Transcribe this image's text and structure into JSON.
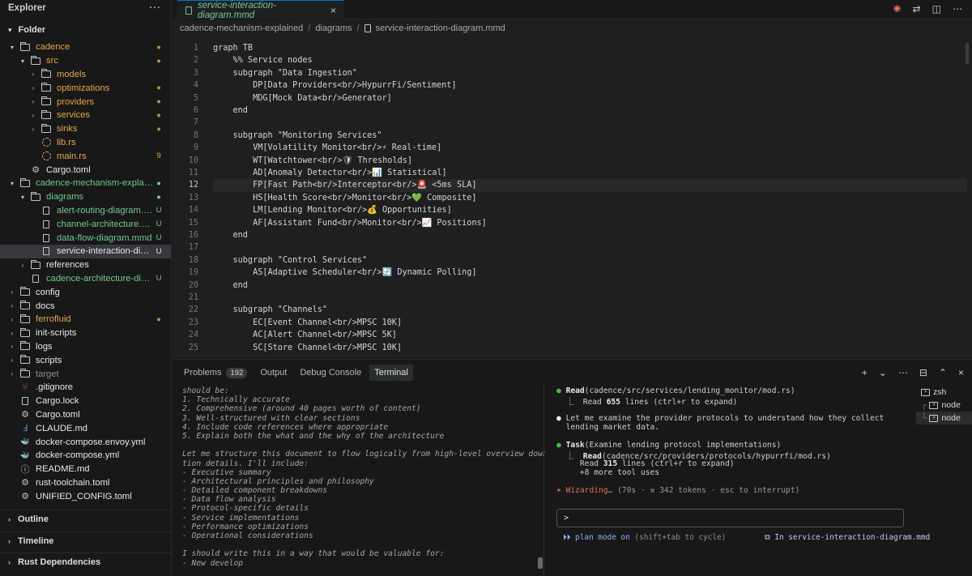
{
  "sidebar": {
    "title": "Explorer",
    "more": "···",
    "folder_header": "Folder",
    "tree": [
      {
        "label": "cadence",
        "kind": "folder",
        "depth": 0,
        "open": true,
        "color": "orange",
        "badge": "●",
        "badge_color": "dim-orange"
      },
      {
        "label": "src",
        "kind": "folder",
        "depth": 1,
        "open": true,
        "color": "orange",
        "badge": "●",
        "badge_color": "dim-orange"
      },
      {
        "label": "models",
        "kind": "folder",
        "depth": 2,
        "open": false,
        "color": "orange",
        "badge": "",
        "badge_color": ""
      },
      {
        "label": "optimizations",
        "kind": "folder",
        "depth": 2,
        "open": false,
        "color": "orange",
        "badge": "●",
        "badge_color": "dim-orange"
      },
      {
        "label": "providers",
        "kind": "folder",
        "depth": 2,
        "open": false,
        "color": "orange",
        "badge": "●",
        "badge_color": "dim-orange"
      },
      {
        "label": "services",
        "kind": "folder",
        "depth": 2,
        "open": false,
        "color": "orange",
        "badge": "●",
        "badge_color": "dim-orange"
      },
      {
        "label": "sinks",
        "kind": "folder",
        "depth": 2,
        "open": false,
        "color": "orange",
        "badge": "●",
        "badge_color": "dim-orange"
      },
      {
        "label": "lib.rs",
        "kind": "rust",
        "depth": 2,
        "color": "orange",
        "badge": "",
        "badge_color": ""
      },
      {
        "label": "main.rs",
        "kind": "rust",
        "depth": 2,
        "color": "orange",
        "badge": "9",
        "badge_color": "orange"
      },
      {
        "label": "Cargo.toml",
        "kind": "gear",
        "depth": 1,
        "color": "white",
        "badge": "",
        "badge_color": ""
      },
      {
        "label": "cadence-mechanism-explained",
        "kind": "folder",
        "depth": 0,
        "open": true,
        "color": "green",
        "badge": "●",
        "badge_color": "green"
      },
      {
        "label": "diagrams",
        "kind": "folder",
        "depth": 1,
        "open": true,
        "color": "green",
        "badge": "●",
        "badge_color": "green"
      },
      {
        "label": "alert-routing-diagram.mmd",
        "kind": "file",
        "depth": 2,
        "color": "green",
        "badge": "U",
        "badge_color": "green"
      },
      {
        "label": "channel-architecture.mmd",
        "kind": "file",
        "depth": 2,
        "color": "green",
        "badge": "U",
        "badge_color": "green"
      },
      {
        "label": "data-flow-diagram.mmd",
        "kind": "file",
        "depth": 2,
        "color": "green",
        "badge": "U",
        "badge_color": "green"
      },
      {
        "label": "service-interaction-diagr...",
        "kind": "file",
        "depth": 2,
        "color": "white",
        "badge": "U",
        "badge_color": "white",
        "selected": true
      },
      {
        "label": "references",
        "kind": "folder",
        "depth": 1,
        "open": false,
        "color": "white",
        "badge": "",
        "badge_color": ""
      },
      {
        "label": "cadence-architecture-diagra...",
        "kind": "file",
        "depth": 1,
        "color": "green",
        "badge": "U",
        "badge_color": "green"
      },
      {
        "label": "config",
        "kind": "folder",
        "depth": 0,
        "open": false,
        "color": "white",
        "badge": "",
        "badge_color": ""
      },
      {
        "label": "docs",
        "kind": "folder",
        "depth": 0,
        "open": false,
        "color": "white",
        "badge": "",
        "badge_color": ""
      },
      {
        "label": "ferrofluid",
        "kind": "folder",
        "depth": 0,
        "open": false,
        "color": "orange",
        "badge": "●",
        "badge_color": "dim-orange"
      },
      {
        "label": "init-scripts",
        "kind": "folder",
        "depth": 0,
        "open": false,
        "color": "white",
        "badge": "",
        "badge_color": ""
      },
      {
        "label": "logs",
        "kind": "folder",
        "depth": 0,
        "open": false,
        "color": "white",
        "badge": "",
        "badge_color": ""
      },
      {
        "label": "scripts",
        "kind": "folder",
        "depth": 0,
        "open": false,
        "color": "white",
        "badge": "",
        "badge_color": ""
      },
      {
        "label": "target",
        "kind": "folder",
        "depth": 0,
        "open": false,
        "color": "dim",
        "badge": "",
        "badge_color": ""
      },
      {
        "label": ".gitignore",
        "kind": "git",
        "depth": 0,
        "color": "white",
        "badge": "",
        "badge_color": ""
      },
      {
        "label": "Cargo.lock",
        "kind": "file",
        "depth": 0,
        "color": "white",
        "badge": "",
        "badge_color": ""
      },
      {
        "label": "Cargo.toml",
        "kind": "gear",
        "depth": 0,
        "color": "white",
        "badge": "",
        "badge_color": ""
      },
      {
        "label": "CLAUDE.md",
        "kind": "md",
        "depth": 0,
        "color": "white",
        "badge": "",
        "badge_color": ""
      },
      {
        "label": "docker-compose.envoy.yml",
        "kind": "docker",
        "depth": 0,
        "color": "white",
        "badge": "",
        "badge_color": ""
      },
      {
        "label": "docker-compose.yml",
        "kind": "docker",
        "depth": 0,
        "color": "white",
        "badge": "",
        "badge_color": ""
      },
      {
        "label": "README.md",
        "kind": "info",
        "depth": 0,
        "color": "white",
        "badge": "",
        "badge_color": ""
      },
      {
        "label": "rust-toolchain.toml",
        "kind": "gear",
        "depth": 0,
        "color": "white",
        "badge": "",
        "badge_color": ""
      },
      {
        "label": "UNIFIED_CONFIG.toml",
        "kind": "gear",
        "depth": 0,
        "color": "white",
        "badge": "",
        "badge_color": ""
      }
    ],
    "sections": [
      "Outline",
      "Timeline",
      "Rust Dependencies"
    ]
  },
  "editor": {
    "tab_label": "service-interaction-diagram.mmd",
    "tab_close": "×",
    "breadcrumb": [
      "cadence-mechanism-explained",
      "diagrams",
      "service-interaction-diagram.mmd"
    ],
    "active_line": 12,
    "lines": [
      "graph TB",
      "    %% Service nodes",
      "    subgraph \"Data Ingestion\"",
      "        DP[Data Providers<br/>HypurrFi/Sentiment]",
      "        MDG[Mock Data<br/>Generator]",
      "    end",
      "",
      "    subgraph \"Monitoring Services\"",
      "        VM[Volatility Monitor<br/>⚡ Real-time]",
      "        WT[Watchtower<br/>🛡 Thresholds]",
      "        AD[Anomaly Detector<br/>📊 Statistical]",
      "        FP[Fast Path<br/>Interceptor<br/>🚨 <5ms SLA]",
      "        HS[Health Score<br/>Monitor<br/>💚 Composite]",
      "        LM[Lending Monitor<br/>💰 Opportunities]",
      "        AF[Assistant Fund<br/>Monitor<br/>📈 Positions]",
      "    end",
      "",
      "    subgraph \"Control Services\"",
      "        AS[Adaptive Scheduler<br/>🔄 Dynamic Polling]",
      "    end",
      "",
      "    subgraph \"Channels\"",
      "        EC[Event Channel<br/>MPSC 10K]",
      "        AC[Alert Channel<br/>MPSC 5K]",
      "        SC[Store Channel<br/>MPSC 10K]"
    ]
  },
  "panel": {
    "tabs": [
      {
        "label": "Problems",
        "badge": "192"
      },
      {
        "label": "Output",
        "badge": ""
      },
      {
        "label": "Debug Console",
        "badge": ""
      },
      {
        "label": "Terminal",
        "badge": "",
        "active": true
      }
    ],
    "actions": [
      "+",
      "⌄",
      "⋯",
      "⊟",
      "⌃",
      "×"
    ],
    "terminal_left": [
      "should be:",
      "1. Technically accurate",
      "2. Comprehensive (around 40 pages worth of content)",
      "3. Well-structured with clear sections",
      "4. Include code references where appropriate",
      "5. Explain both the what and the why of the architecture",
      "",
      "Let me structure this document to flow logically from high-level overview down to implementa",
      "tion details. I'll include:",
      "- Executive summary",
      "- Architectural principles and philosophy",
      "- Detailed component breakdowns",
      "- Data flow analysis",
      "- Protocol-specific details",
      "- Service implementations",
      "- Performance optimizations",
      "- Operational considerations",
      "",
      "I should write this in a way that would be valuable for:",
      "- New develop"
    ],
    "terminal_right": {
      "read1_tool": "Read",
      "read1_path": "(cadence/src/services/lending_monitor/mod.rs)",
      "read1_result_prefix": "⎿  Read ",
      "read1_count": "655",
      "read1_result_suffix": " lines (ctrl+r to expand)",
      "msg1": "Let me examine the provider protocols to understand how they collect",
      "msg2": "lending market data.",
      "task_tool": "Task",
      "task_desc": "(Examine lending protocol implementations)",
      "read2_prefix": "⎿  ",
      "read2_tool": "Read",
      "read2_path": "(cadence/src/providers/protocols/hypurrfi/mod.rs)",
      "read2_result_prefix": "   Read ",
      "read2_count": "315",
      "read2_result_suffix": " lines (ctrl+r to expand)",
      "more_tools": "   +8 more tool uses",
      "status_star": "✶",
      "status_word": "Wizarding…",
      "status_detail": " (70s · ⚒ 342 tokens · esc to interrupt)",
      "prompt": ">",
      "mode_arrows": "⏵⏵",
      "mode_text": "plan mode on",
      "mode_hint": " (shift+tab to cycle)",
      "in_file": "⧉ In service-interaction-diagram.mmd"
    },
    "terminal_list": [
      {
        "label": "zsh",
        "prefix": ""
      },
      {
        "label": "node",
        "prefix": "┌"
      },
      {
        "label": "node",
        "prefix": "└",
        "selected": true
      }
    ]
  }
}
